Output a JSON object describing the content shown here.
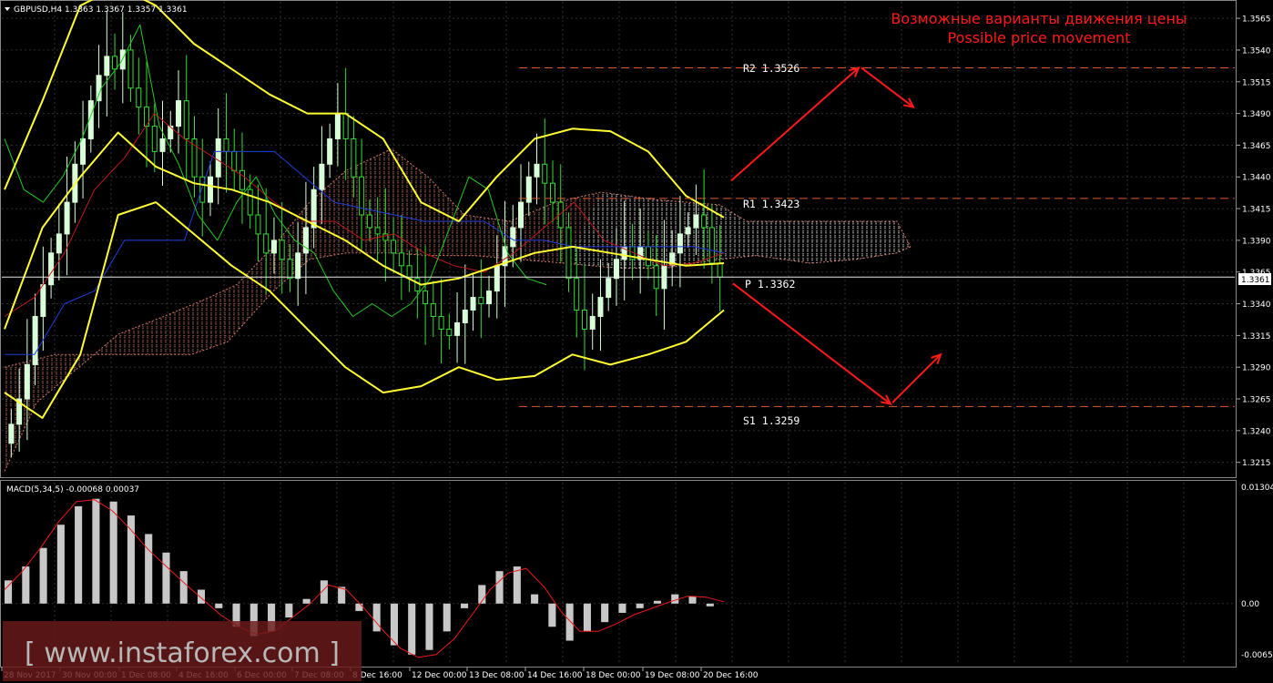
{
  "colors": {
    "background": "#000000",
    "grid": "#2f2f2f",
    "bull": "#d8ffd8",
    "bear": "#33dd33",
    "bollinger": "#ffff33",
    "kijun": "#c01818",
    "tenkan": "#1f3fdd",
    "chikou": "#22cc22",
    "cloud_a": "#d87a6a",
    "cloud_b": "#e8e8e8",
    "level": "#d85a30",
    "arrow": "#ff1a1a",
    "macd_hist": "#c8c8c8",
    "macd_signal": "#ee1a1a",
    "price_line": "#e8e8e8",
    "watermark_bg": "#6a1a1a",
    "watermark_text": "#b8b8b8"
  },
  "header": {
    "symbol_info": "GBPUSD,H4  1.3363 1.3367 1.3357 1.3361",
    "menu_icon": "triangle-down-icon"
  },
  "annotation": {
    "line_ru": "Возможные варианты движения цены",
    "line_en": "Possible price movement"
  },
  "levels": [
    {
      "name": "R2",
      "label": "R2  1.3526",
      "price": 1.3526
    },
    {
      "name": "R1",
      "label": "R1  1.3423",
      "price": 1.3423
    },
    {
      "name": "P",
      "label": "P  1.3362",
      "price": 1.3362
    },
    {
      "name": "S1",
      "label": "S1  1.3259",
      "price": 1.3259
    }
  ],
  "current_price": "1.3361",
  "macd_label": "MACD(5,34,5) -0.00068 0.00037",
  "watermark": "[ www.instaforex.com ]",
  "chart_data": {
    "type": "line",
    "instrument": "GBPUSD",
    "timeframe": "H4",
    "price_axis": {
      "ticks": [
        "1.3565",
        "1.3540",
        "1.3515",
        "1.3490",
        "1.3465",
        "1.3440",
        "1.3415",
        "1.3390",
        "1.3365",
        "1.3340",
        "1.3315",
        "1.3290",
        "1.3265",
        "1.3240",
        "1.3215"
      ],
      "range": [
        1.3204,
        1.3578
      ]
    },
    "macd_axis": {
      "ticks": [
        "0.01304",
        "0.00",
        "-0.00652"
      ],
      "range": [
        -0.0066,
        0.01304
      ]
    },
    "time_axis": {
      "ticks": [
        "28 Nov 2017",
        "30 Nov 00:00",
        "1 Dec 08:00",
        "4 Dec 16:00",
        "6 Dec 00:00",
        "7 Dec 08:00",
        "8 Dec 16:00",
        "12 Dec 00:00",
        "13 Dec 08:00",
        "14 Dec 16:00",
        "18 Dec 00:00",
        "19 Dec 08:00",
        "20 Dec 16:00"
      ]
    },
    "series": [
      {
        "name": "GBPUSD,H4",
        "kind": "candles",
        "close": [
          1.3245,
          1.3265,
          1.3292,
          1.333,
          1.3355,
          1.338,
          1.3395,
          1.342,
          1.345,
          1.347,
          1.35,
          1.352,
          1.3535,
          1.3525,
          1.354,
          1.351,
          1.3495,
          1.348,
          1.346,
          1.347,
          1.348,
          1.35,
          1.347,
          1.344,
          1.342,
          1.344,
          1.347,
          1.346,
          1.3445,
          1.343,
          1.341,
          1.3395,
          1.338,
          1.339,
          1.3375,
          1.336,
          1.338,
          1.34,
          1.343,
          1.345,
          1.347,
          1.349,
          1.347,
          1.344,
          1.341,
          1.34,
          1.3395,
          1.339,
          1.338,
          1.337,
          1.336,
          1.335,
          1.334,
          1.333,
          1.332,
          1.3315,
          1.3325,
          1.3335,
          1.3345,
          1.334,
          1.335,
          1.337,
          1.3385,
          1.34,
          1.342,
          1.344,
          1.345,
          1.3435,
          1.342,
          1.34,
          1.336,
          1.3335,
          1.332,
          1.333,
          1.3345,
          1.336,
          1.3375,
          1.3385,
          1.3375,
          1.3385,
          1.337,
          1.3352,
          1.337,
          1.338,
          1.3395,
          1.34,
          1.341,
          1.34,
          1.3372,
          1.3361
        ]
      },
      {
        "name": "Bollinger upper",
        "kind": "line",
        "values": [
          1.343,
          1.35,
          1.3575,
          1.359,
          1.3575,
          1.3545,
          1.3525,
          1.3505,
          1.349,
          1.349,
          1.347,
          1.342,
          1.3405,
          1.344,
          1.347,
          1.3478,
          1.3476,
          1.346,
          1.3425,
          1.3408
        ]
      },
      {
        "name": "Bollinger middle",
        "kind": "line",
        "values": [
          1.332,
          1.34,
          1.344,
          1.3475,
          1.3448,
          1.3435,
          1.343,
          1.342,
          1.3405,
          1.339,
          1.337,
          1.3355,
          1.336,
          1.337,
          1.338,
          1.3385,
          1.338,
          1.3375,
          1.337,
          1.3372
        ]
      },
      {
        "name": "Bollinger lower",
        "kind": "line",
        "values": [
          1.327,
          1.325,
          1.33,
          1.341,
          1.342,
          1.3395,
          1.337,
          1.335,
          1.332,
          1.329,
          1.327,
          1.3275,
          1.329,
          1.328,
          1.3283,
          1.33,
          1.3292,
          1.33,
          1.331,
          1.3335
        ]
      },
      {
        "name": "MACD histogram",
        "kind": "bars",
        "values": [
          0.0025,
          0.004,
          0.006,
          0.0085,
          0.0105,
          0.0113,
          0.011,
          0.0095,
          0.0075,
          0.0055,
          0.0035,
          0.0015,
          -0.0005,
          -0.0025,
          -0.0035,
          -0.003,
          -0.0015,
          0.0005,
          0.0025,
          0.0018,
          -0.0008,
          -0.003,
          -0.0045,
          -0.0055,
          -0.005,
          -0.003,
          -0.0005,
          0.002,
          0.0035,
          0.004,
          0.001,
          -0.0025,
          -0.004,
          -0.003,
          -0.002,
          -0.001,
          -0.0005,
          0.0003,
          0.001,
          0.0008,
          -0.0003
        ]
      },
      {
        "name": "MACD signal",
        "kind": "line",
        "values": [
          0.0015,
          0.0035,
          0.006,
          0.0088,
          0.011,
          0.0112,
          0.01,
          0.008,
          0.0058,
          0.004,
          0.0022,
          0.0005,
          -0.0012,
          -0.0025,
          -0.0033,
          -0.003,
          -0.0015,
          0.0,
          0.002,
          0.0015,
          -0.0005,
          -0.0028,
          -0.0048,
          -0.0058,
          -0.0055,
          -0.0038,
          -0.0012,
          0.0015,
          0.0033,
          0.0038,
          0.0018,
          -0.001,
          -0.003,
          -0.003,
          -0.0022,
          -0.0012,
          -0.0005,
          0.0002,
          0.0008,
          0.0007,
          0.0002
        ]
      }
    ]
  }
}
